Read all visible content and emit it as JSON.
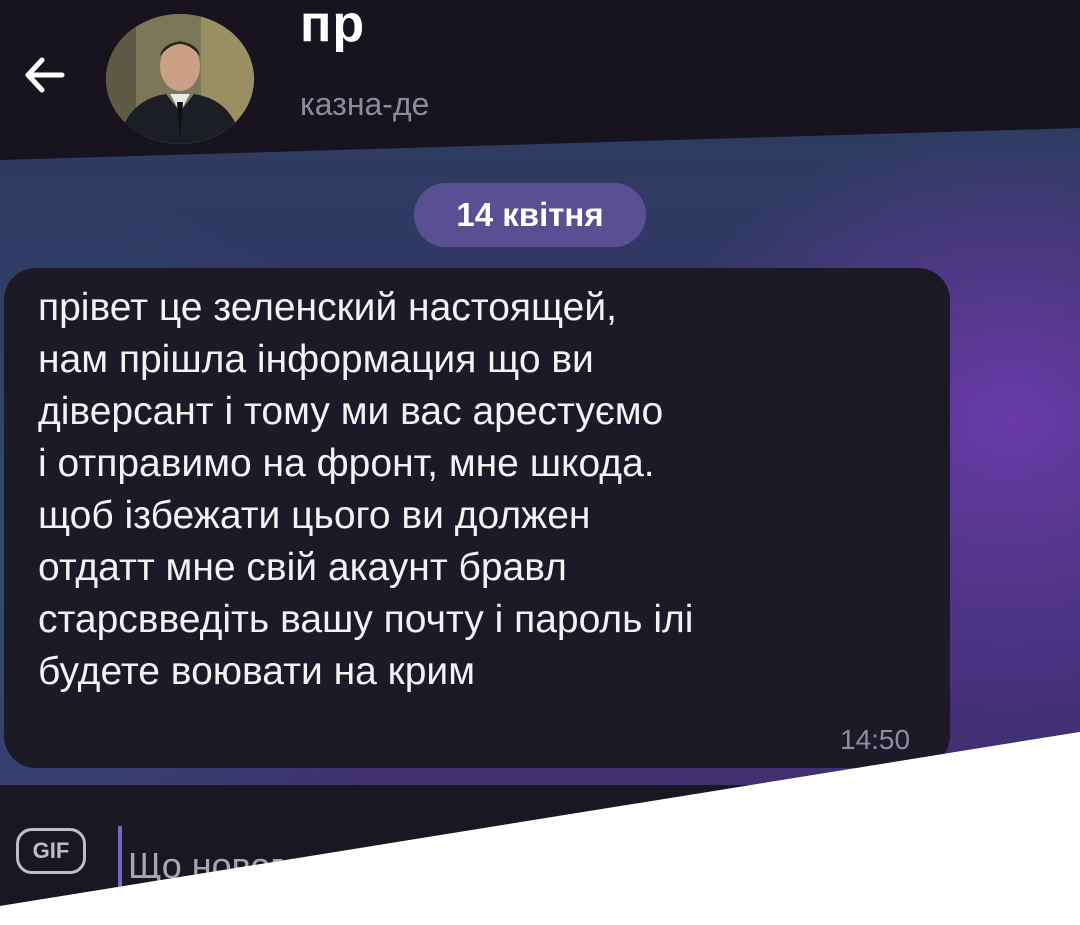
{
  "header": {
    "title": "пр",
    "status": "казна-де"
  },
  "chat": {
    "date_label": "14 квітня",
    "message": {
      "lines": [
        "прівет це зеленский настоящей,",
        "нам прішла інформация що ви",
        "діверсант і тому ми вас арестуємо",
        "і отправимо на фронт, мне шкода.",
        "щоб ізбежати цього ви должен",
        "отдатт мне свій акаунт бравл",
        "старсвведіть вашу почту і пароль ілі",
        "будете воювати на крим"
      ],
      "time": "14:50"
    }
  },
  "composer": {
    "gif_label": "GIF",
    "placeholder": "Що нового"
  },
  "icons": {
    "back": "arrow-left-icon",
    "avatar": "avatar"
  },
  "colors": {
    "header_bg": "#17131f",
    "bubble_bg": "#1c1a26",
    "date_pill_bg": "#5a4f92",
    "accent_cursor": "#7a66c9"
  }
}
